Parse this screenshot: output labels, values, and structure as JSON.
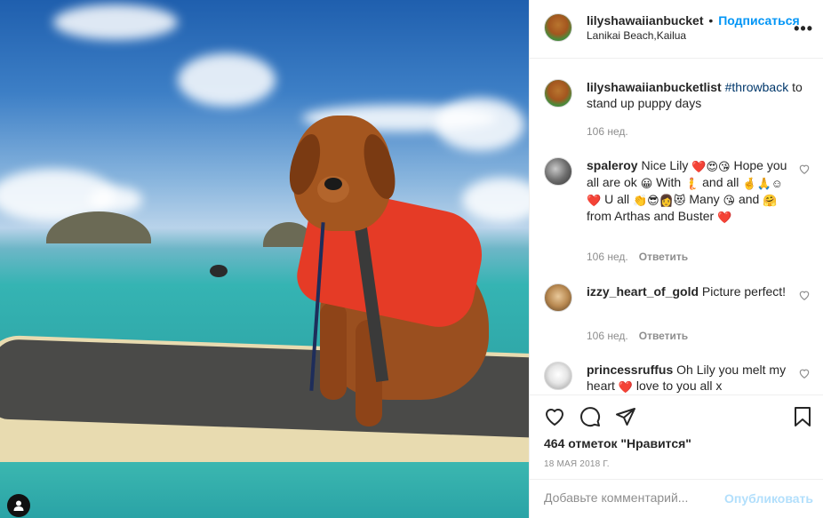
{
  "post": {
    "author": "lilyshawaiianbucket",
    "separator": "•",
    "follow_label": "Подписаться",
    "location": "Lanikai Beach,Kailua",
    "more_label": "•••"
  },
  "caption": {
    "username": "lilyshawaiianbucketlist",
    "hashtag": "#throwback",
    "text": " to stand up puppy days",
    "time": "106 нед."
  },
  "comments": [
    {
      "username": "spaleroy",
      "text_parts": [
        "Nice Lily ",
        "❤️",
        "😍",
        "😘",
        " Hope you all are ok ",
        "😀",
        " With ",
        "🧜",
        " and all ",
        "🤞",
        "🙏",
        "☺",
        " ",
        "❤️",
        " U all ",
        "👏",
        "😎",
        "👩",
        "😻",
        " Many ",
        "😘",
        " and ",
        "🤗",
        " from Arthas and Buster ",
        "❤️"
      ],
      "time": "106 нед.",
      "reply": "Ответить"
    },
    {
      "username": "izzy_heart_of_gold",
      "text": " Picture perfect!",
      "time": "106 нед.",
      "reply": "Ответить"
    },
    {
      "username": "princessruffus",
      "text": " Oh Lily you melt my heart ",
      "emoji": "❤️",
      "text2": " love to you all x"
    }
  ],
  "engagement": {
    "likes": "464 отметок \"Нравится\"",
    "date": "18 МАЯ 2018 Г."
  },
  "composer": {
    "placeholder": "Добавьте комментарий...",
    "publish_label": "Опубликовать"
  },
  "icons": {
    "like": "heart-icon",
    "comment": "comment-icon",
    "share": "share-icon",
    "save": "bookmark-icon",
    "user": "user-icon"
  },
  "colors": {
    "accent": "#0095f6",
    "publish_disabled": "#b2dffc",
    "muted": "#8e8e8e",
    "text": "#262626"
  }
}
